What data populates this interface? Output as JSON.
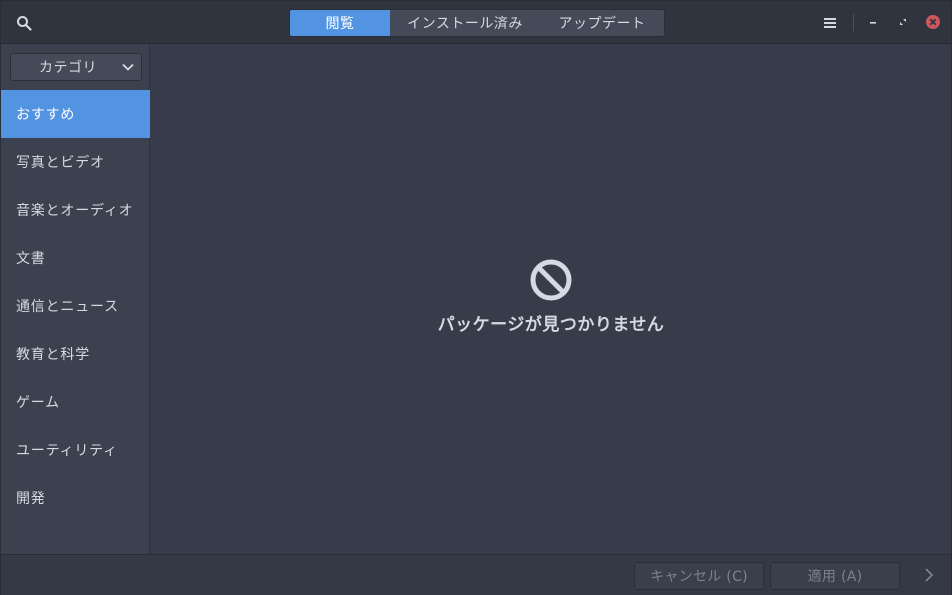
{
  "header": {
    "search_icon": "search-icon",
    "tabs": [
      {
        "label": "閲覧",
        "active": true
      },
      {
        "label": "インストール済み",
        "active": false
      },
      {
        "label": "アップデート",
        "active": false
      }
    ],
    "menu_icon": "hamburger-menu-icon",
    "window_controls": [
      "minimize-icon",
      "maximize-icon",
      "close-icon"
    ],
    "accent_color": "#5294e2",
    "close_color": "#cc575d"
  },
  "sidebar": {
    "dropdown": {
      "label": "カテゴリ",
      "icon": "chevron-down-icon"
    },
    "items": [
      {
        "label": "おすすめ",
        "active": true
      },
      {
        "label": "写真とビデオ",
        "active": false
      },
      {
        "label": "音楽とオーディオ",
        "active": false
      },
      {
        "label": "文書",
        "active": false
      },
      {
        "label": "通信とニュース",
        "active": false
      },
      {
        "label": "教育と科学",
        "active": false
      },
      {
        "label": "ゲーム",
        "active": false
      },
      {
        "label": "ユーティリティ",
        "active": false
      },
      {
        "label": "開発",
        "active": false
      }
    ]
  },
  "main": {
    "empty_icon": "no-entry-icon",
    "empty_message": "パッケージが見つかりません"
  },
  "actionbar": {
    "cancel_label": "キャンセル (C)",
    "apply_label": "適用 (A)",
    "next_icon": "chevron-right-icon"
  }
}
